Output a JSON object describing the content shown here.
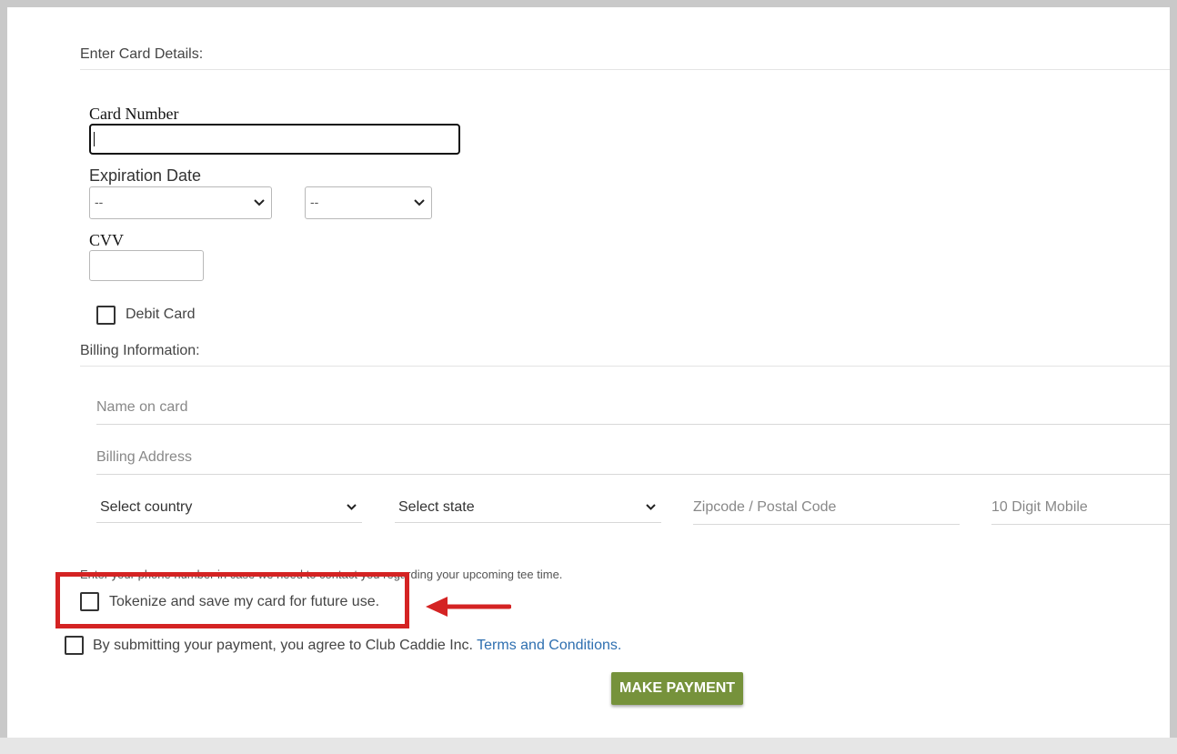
{
  "card_section": {
    "title": "Enter Card Details:",
    "card_number_label": "Card Number",
    "card_number_value": "",
    "expiration_label": "Expiration Date",
    "exp_month_value": "--",
    "exp_year_value": "--",
    "cvv_label": "CVV",
    "cvv_value": "",
    "debit_card_label": "Debit Card"
  },
  "billing_section": {
    "title": "Billing Information:",
    "name_placeholder": "Name on card",
    "address_placeholder": "Billing Address",
    "country_value": "Select country",
    "state_value": "Select state",
    "zip_placeholder": "Zipcode / Postal Code",
    "mobile_placeholder": "10 Digit Mobile",
    "phone_hint": "Enter your phone number in case we need to contact you regarding your upcoming tee time."
  },
  "tokenize": {
    "label": "Tokenize and save my card for future use."
  },
  "agreement": {
    "text": "By submitting your payment, you agree to Club Caddie Inc.",
    "link_text": "Terms and Conditions."
  },
  "actions": {
    "pay_label": "MAKE PAYMENT"
  },
  "colors": {
    "accent_green": "#76923b",
    "annotation_red": "#d42323",
    "link_blue": "#2e6fb0"
  }
}
